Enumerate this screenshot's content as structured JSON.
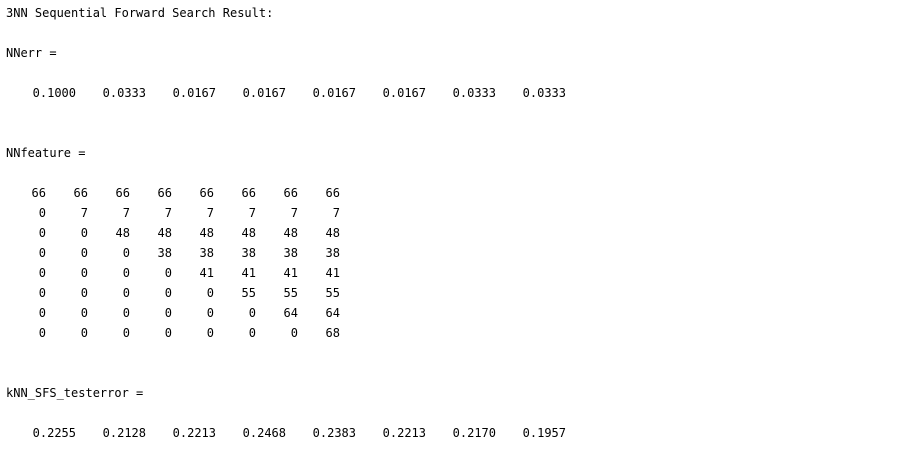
{
  "header": {
    "title": "3NN Sequential Forward Search Result:"
  },
  "nnerr": {
    "label": "NNerr =",
    "values": [
      "0.1000",
      "0.0333",
      "0.0167",
      "0.0167",
      "0.0167",
      "0.0167",
      "0.0333",
      "0.0333"
    ]
  },
  "nnfeature": {
    "label": "NNfeature =",
    "rows": [
      [
        "66",
        "66",
        "66",
        "66",
        "66",
        "66",
        "66",
        "66"
      ],
      [
        "0",
        "7",
        "7",
        "7",
        "7",
        "7",
        "7",
        "7"
      ],
      [
        "0",
        "0",
        "48",
        "48",
        "48",
        "48",
        "48",
        "48"
      ],
      [
        "0",
        "0",
        "0",
        "38",
        "38",
        "38",
        "38",
        "38"
      ],
      [
        "0",
        "0",
        "0",
        "0",
        "41",
        "41",
        "41",
        "41"
      ],
      [
        "0",
        "0",
        "0",
        "0",
        "0",
        "55",
        "55",
        "55"
      ],
      [
        "0",
        "0",
        "0",
        "0",
        "0",
        "0",
        "64",
        "64"
      ],
      [
        "0",
        "0",
        "0",
        "0",
        "0",
        "0",
        "0",
        "68"
      ]
    ]
  },
  "testerror": {
    "label": "kNN_SFS_testerror =",
    "values": [
      "0.2255",
      "0.2128",
      "0.2213",
      "0.2468",
      "0.2383",
      "0.2213",
      "0.2170",
      "0.1957"
    ]
  }
}
